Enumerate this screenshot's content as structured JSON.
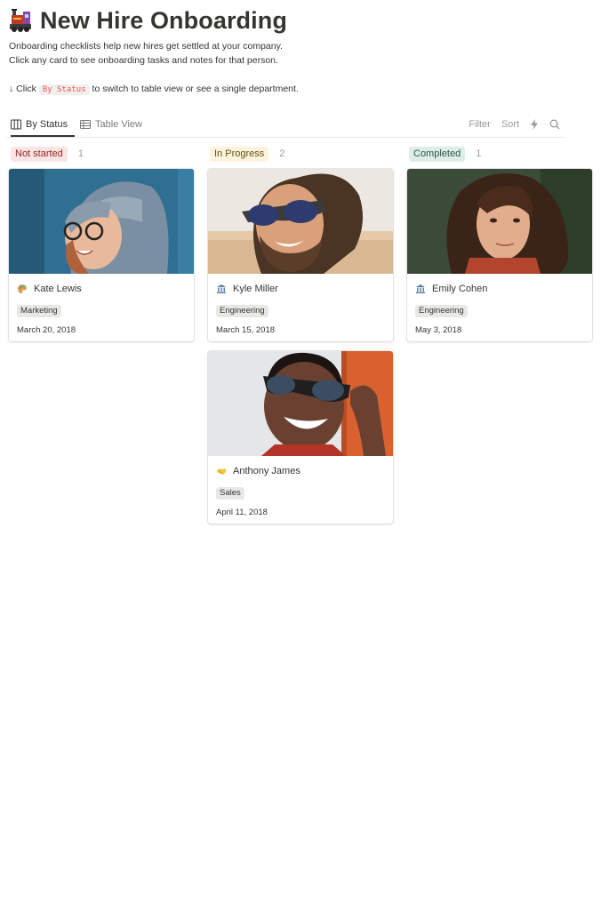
{
  "page": {
    "title": "New Hire Onboarding",
    "icon": "locomotive-icon",
    "description": [
      "Onboarding checklists help new hires get settled at your company.",
      "Click any card to see onboarding tasks and notes for that person."
    ],
    "hint": {
      "prefix": "↓ Click",
      "code": "By Status",
      "suffix": "to switch to table view or see a single department."
    }
  },
  "views": {
    "tabs": [
      {
        "label": "By Status",
        "icon": "board-icon",
        "active": true
      },
      {
        "label": "Table View",
        "icon": "table-icon",
        "active": false
      }
    ],
    "tools": {
      "filter": "Filter",
      "sort": "Sort",
      "automation_icon": "lightning-icon",
      "search_icon": "search-icon"
    }
  },
  "columns": [
    {
      "status": "Not started",
      "count": "1",
      "color_bg": "#fbe4e4",
      "color_fg": "#93261f"
    },
    {
      "status": "In Progress",
      "count": "2",
      "color_bg": "#fbf3db",
      "color_fg": "#6b4e16"
    },
    {
      "status": "Completed",
      "count": "1",
      "color_bg": "#ddedea",
      "color_fg": "#2b593f"
    }
  ],
  "cards": [
    {
      "name": "Kate Lewis",
      "emoji": "palette-icon",
      "department": "Marketing",
      "start_date": "March 20, 2018"
    },
    {
      "name": "Kyle Miller",
      "emoji": "bank-icon",
      "department": "Engineering",
      "start_date": "March 15, 2018"
    },
    {
      "name": "Emily Cohen",
      "emoji": "bank-icon",
      "department": "Engineering",
      "start_date": "May 3, 2018"
    },
    {
      "name": "Anthony James",
      "emoji": "handshake-icon",
      "department": "Sales",
      "start_date": "April 11, 2018"
    }
  ]
}
